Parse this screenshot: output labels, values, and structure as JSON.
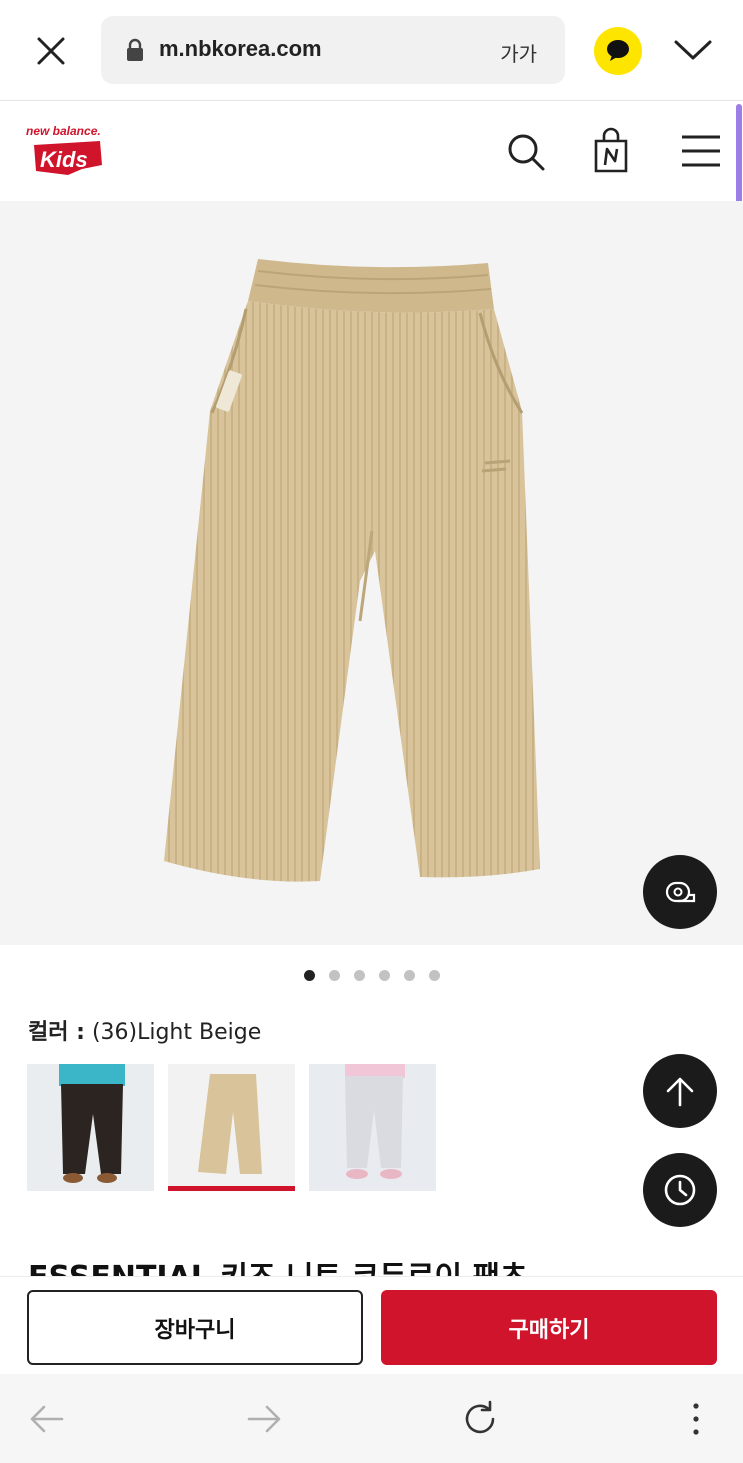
{
  "browser": {
    "url": "m.nbkorea.com",
    "font_size_label": "가가",
    "accent_kakao": "#fee500"
  },
  "site": {
    "brand_top": "new balance.",
    "brand_bottom": "Kids"
  },
  "product": {
    "image_alt": "Light beige corduroy pants",
    "image_count": 6,
    "active_image_index": 0,
    "color_label": "컬러 :",
    "color_value": "(36)Light Beige",
    "swatches": [
      {
        "name": "dark-brown-pants-swatch",
        "selected": false
      },
      {
        "name": "light-beige-pants-swatch",
        "selected": true
      },
      {
        "name": "light-grey-pants-swatch",
        "selected": false
      }
    ],
    "title_peek": "ESSENTIAL 키즈 니트 코듀로이 팬츠"
  },
  "actions": {
    "cart_label": "장바구니",
    "buy_label": "구매하기",
    "accent": "#d0142c"
  },
  "fabs": {
    "size_guide_icon": "tape-measure-icon",
    "top_icon": "arrow-up-icon",
    "recent_icon": "clock-icon"
  }
}
